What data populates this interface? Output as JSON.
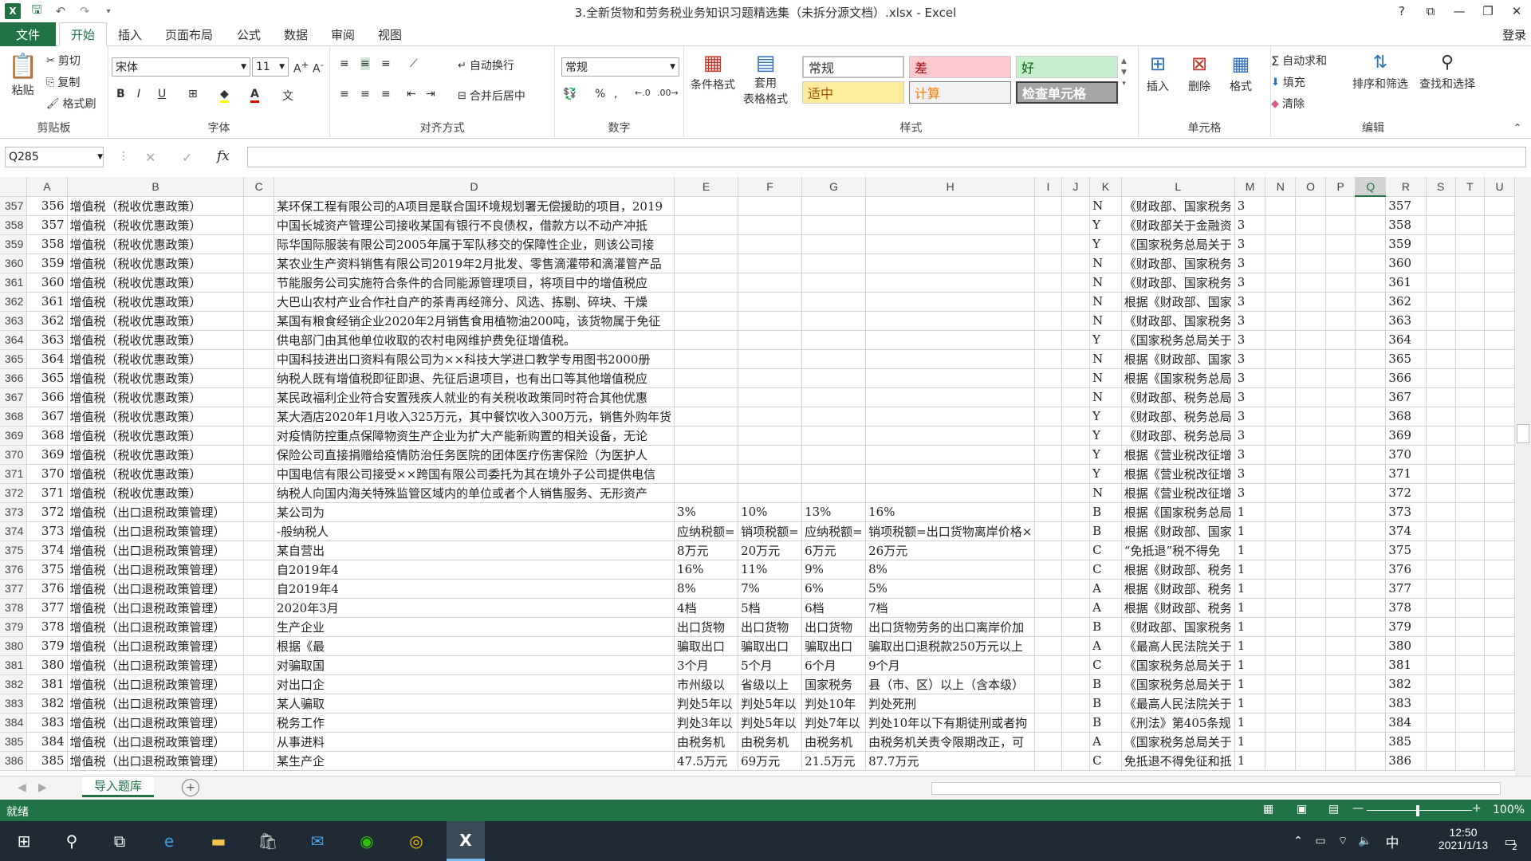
{
  "window": {
    "title": "3.全新货物和劳务税业务知识习题精选集（未拆分源文档）.xlsx - Excel",
    "signin": "登录"
  },
  "tabs": {
    "file": "文件",
    "items": [
      "开始",
      "插入",
      "页面布局",
      "公式",
      "数据",
      "审阅",
      "视图"
    ]
  },
  "ribbon": {
    "clipboard": {
      "paste": "粘贴",
      "cut": "剪切",
      "copy": "复制",
      "format_painter": "格式刷",
      "label": "剪贴板"
    },
    "font": {
      "name": "宋体",
      "size": "11",
      "label": "字体"
    },
    "alignment": {
      "wrap": "自动换行",
      "merge": "合并后居中",
      "label": "对齐方式"
    },
    "number": {
      "format": "常规",
      "label": "数字"
    },
    "styles": {
      "cond": "条件格式",
      "table1": "套用",
      "table2": "表格格式",
      "normal": "常规",
      "bad": "差",
      "good": "好",
      "neutral": "适中",
      "calc": "计算",
      "check": "检查单元格",
      "label": "样式"
    },
    "cells": {
      "insert": "插入",
      "delete": "删除",
      "format": "格式",
      "label": "单元格"
    },
    "editing": {
      "autosum": "自动求和",
      "fill": "填充",
      "clear": "清除",
      "sort": "排序和筛选",
      "find": "查找和选择",
      "label": "编辑"
    }
  },
  "formula": {
    "namebox": "Q285",
    "fx": "fx"
  },
  "columns": [
    "A",
    "B",
    "C",
    "D",
    "E",
    "F",
    "G",
    "H",
    "I",
    "J",
    "K",
    "L",
    "M",
    "N",
    "O",
    "P",
    "Q",
    "R",
    "S",
    "T",
    "U"
  ],
  "rows": [
    {
      "r": "357",
      "a": "356",
      "b": "增值税（税收优惠政策）",
      "d": "某环保工程有限公司的A项目是联合国环境规划署无偿援助的项目，2019",
      "k": "N",
      "l": "《财政部、国家税务",
      "m": "3"
    },
    {
      "r": "358",
      "a": "357",
      "b": "增值税（税收优惠政策）",
      "d": "中国长城资产管理公司接收某国有银行不良债权，借款方以不动产冲抵",
      "k": "Y",
      "l": "《财政部关于金融资",
      "m": "3"
    },
    {
      "r": "359",
      "a": "358",
      "b": "增值税（税收优惠政策）",
      "d": "际华国际服装有限公司2005年属于军队移交的保障性企业，则该公司接",
      "k": "Y",
      "l": "《国家税务总局关于",
      "m": "3"
    },
    {
      "r": "360",
      "a": "359",
      "b": "增值税（税收优惠政策）",
      "d": "某农业生产资料销售有限公司2019年2月批发、零售滴灌带和滴灌管产品",
      "k": "N",
      "l": "《财政部、国家税务",
      "m": "3"
    },
    {
      "r": "361",
      "a": "360",
      "b": "增值税（税收优惠政策）",
      "d": "节能服务公司实施符合条件的合同能源管理项目，将项目中的增值税应",
      "k": "N",
      "l": "《财政部、国家税务",
      "m": "3"
    },
    {
      "r": "362",
      "a": "361",
      "b": "增值税（税收优惠政策）",
      "d": "大巴山农村产业合作社自产的茶青再经筛分、风选、拣剔、碎块、干燥",
      "k": "N",
      "l": "根据《财政部、国家",
      "m": "3"
    },
    {
      "r": "363",
      "a": "362",
      "b": "增值税（税收优惠政策）",
      "d": "某国有粮食经销企业2020年2月销售食用植物油200吨，该货物属于免征",
      "k": "N",
      "l": "《财政部、国家税务",
      "m": "3"
    },
    {
      "r": "364",
      "a": "363",
      "b": "增值税（税收优惠政策）",
      "d": "供电部门由其他单位收取的农村电网维护费免征增值税。",
      "k": "Y",
      "l": "《国家税务总局关于",
      "m": "3"
    },
    {
      "r": "365",
      "a": "364",
      "b": "增值税（税收优惠政策）",
      "d": "中国科技进出口资料有限公司为××科技大学进口教学专用图书2000册",
      "k": "N",
      "l": "根据《财政部、国家",
      "m": "3"
    },
    {
      "r": "366",
      "a": "365",
      "b": "增值税（税收优惠政策）",
      "d": "纳税人既有增值税即征即退、先征后退项目，也有出口等其他增值税应",
      "k": "N",
      "l": "根据《国家税务总局",
      "m": "3"
    },
    {
      "r": "367",
      "a": "366",
      "b": "增值税（税收优惠政策）",
      "d": "某民政福利企业符合安置残疾人就业的有关税收政策同时符合其他优惠",
      "k": "N",
      "l": "《财政部、税务总局",
      "m": "3"
    },
    {
      "r": "368",
      "a": "367",
      "b": "增值税（税收优惠政策）",
      "d": "某大酒店2020年1月收入325万元，其中餐饮收入300万元，销售外购年货",
      "k": "Y",
      "l": "《财政部、税务总局",
      "m": "3"
    },
    {
      "r": "369",
      "a": "368",
      "b": "增值税（税收优惠政策）",
      "d": "对疫情防控重点保障物资生产企业为扩大产能新购置的相关设备，无论",
      "k": "Y",
      "l": "《财政部、税务总局",
      "m": "3"
    },
    {
      "r": "370",
      "a": "369",
      "b": "增值税（税收优惠政策）",
      "d": "保险公司直接捐赠给疫情防治任务医院的团体医疗伤害保险（为医护人",
      "k": "Y",
      "l": "根据《营业税改征增",
      "m": "3"
    },
    {
      "r": "371",
      "a": "370",
      "b": "增值税（税收优惠政策）",
      "d": "中国电信有限公司接受××跨国有限公司委托为其在境外子公司提供电信",
      "k": "Y",
      "l": "根据《营业税改征增",
      "m": "3"
    },
    {
      "r": "372",
      "a": "371",
      "b": "增值税（税收优惠政策）",
      "d": "纳税人向国内海关特殊监管区域内的单位或者个人销售服务、无形资产",
      "k": "N",
      "l": "根据《营业税改征增",
      "m": "3"
    },
    {
      "r": "373",
      "a": "372",
      "b": "增值税（出口退税政策管理）",
      "d": "某公司为",
      "e": "3%",
      "f": "10%",
      "g": "13%",
      "h": "16%",
      "k": "B",
      "l": "根据《国家税务总局",
      "m": "1"
    },
    {
      "r": "374",
      "a": "373",
      "b": "增值税（出口退税政策管理）",
      "d": "-般纳税人",
      "e": "应纳税额=",
      "f": "销项税额=",
      "g": "应纳税额=",
      "h": "销项税额=出口货物离岸价格×",
      "k": "B",
      "l": "根据《财政部、国家",
      "m": "1"
    },
    {
      "r": "375",
      "a": "374",
      "b": "增值税（出口退税政策管理）",
      "d": "某自营出",
      "e": "8万元",
      "f": "20万元",
      "g": "6万元",
      "h": "26万元",
      "k": "C",
      "l": "“免抵退”税不得免",
      "m": "1"
    },
    {
      "r": "376",
      "a": "375",
      "b": "增值税（出口退税政策管理）",
      "d": "自2019年4",
      "e": "16%",
      "f": "11%",
      "g": "9%",
      "h": "8%",
      "k": "C",
      "l": "根据《财政部、税务",
      "m": "1"
    },
    {
      "r": "377",
      "a": "376",
      "b": "增值税（出口退税政策管理）",
      "d": "自2019年4",
      "e": "8%",
      "f": "7%",
      "g": "6%",
      "h": "5%",
      "k": "A",
      "l": "根据《财政部、税务",
      "m": "1"
    },
    {
      "r": "378",
      "a": "377",
      "b": "增值税（出口退税政策管理）",
      "d": "2020年3月",
      "e": "4档",
      "f": "5档",
      "g": "6档",
      "h": "7档",
      "k": "A",
      "l": "根据《财政部、税务",
      "m": "1"
    },
    {
      "r": "379",
      "a": "378",
      "b": "增值税（出口退税政策管理）",
      "d": "生产企业",
      "e": "出口货物",
      "f": "出口货物",
      "g": "出口货物",
      "h": "出口货物劳务的出口离岸价加",
      "k": "B",
      "l": "《财政部、国家税务",
      "m": "1"
    },
    {
      "r": "380",
      "a": "379",
      "b": "增值税（出口退税政策管理）",
      "d": "根据《最",
      "e": "骗取出口",
      "f": "骗取出口",
      "g": "骗取出口",
      "h": "骗取出口退税款250万元以上",
      "k": "A",
      "l": "《最高人民法院关于",
      "m": "1"
    },
    {
      "r": "381",
      "a": "380",
      "b": "增值税（出口退税政策管理）",
      "d": "对骗取国",
      "e": "3个月",
      "f": "5个月",
      "g": "6个月",
      "h": "9个月",
      "k": "C",
      "l": "《国家税务总局关于",
      "m": "1"
    },
    {
      "r": "382",
      "a": "381",
      "b": "增值税（出口退税政策管理）",
      "d": "对出口企",
      "e": "市州级以",
      "f": "省级以上",
      "g": "国家税务",
      "h": "县（市、区）以上（含本级）",
      "k": "B",
      "l": "《国家税务总局关于",
      "m": "1"
    },
    {
      "r": "383",
      "a": "382",
      "b": "增值税（出口退税政策管理）",
      "d": "某人骗取",
      "e": "判处5年以",
      "f": "判处5年以",
      "g": "判处10年",
      "h": "判处死刑",
      "k": "B",
      "l": "《最高人民法院关于",
      "m": "1"
    },
    {
      "r": "384",
      "a": "383",
      "b": "增值税（出口退税政策管理）",
      "d": "税务工作",
      "e": "判处3年以",
      "f": "判处5年以",
      "g": "判处7年以",
      "h": "判处10年以下有期徒刑或者拘",
      "k": "B",
      "l": "《刑法》第405条规",
      "m": "1"
    },
    {
      "r": "385",
      "a": "384",
      "b": "增值税（出口退税政策管理）",
      "d": "从事进料",
      "e": "由税务机",
      "f": "由税务机",
      "g": "由税务机",
      "h": "由税务机关责令限期改正，可",
      "k": "A",
      "l": "《国家税务总局关于",
      "m": "1"
    },
    {
      "r": "386",
      "a": "385",
      "b": "增值税（出口退税政策管理）",
      "d": "某生产企",
      "e": "47.5万元",
      "f": "69万元",
      "g": "21.5万元",
      "h": "87.7万元",
      "k": "C",
      "l": "免抵退不得免征和抵",
      "m": "1"
    }
  ],
  "sheet": {
    "tab": "导入题库",
    "add": "+"
  },
  "status": {
    "ready": "就绪",
    "zoom": "100%"
  },
  "taskbar": {
    "time": "12:50",
    "date": "2021/1/13",
    "ime": "中",
    "notif": "2"
  }
}
